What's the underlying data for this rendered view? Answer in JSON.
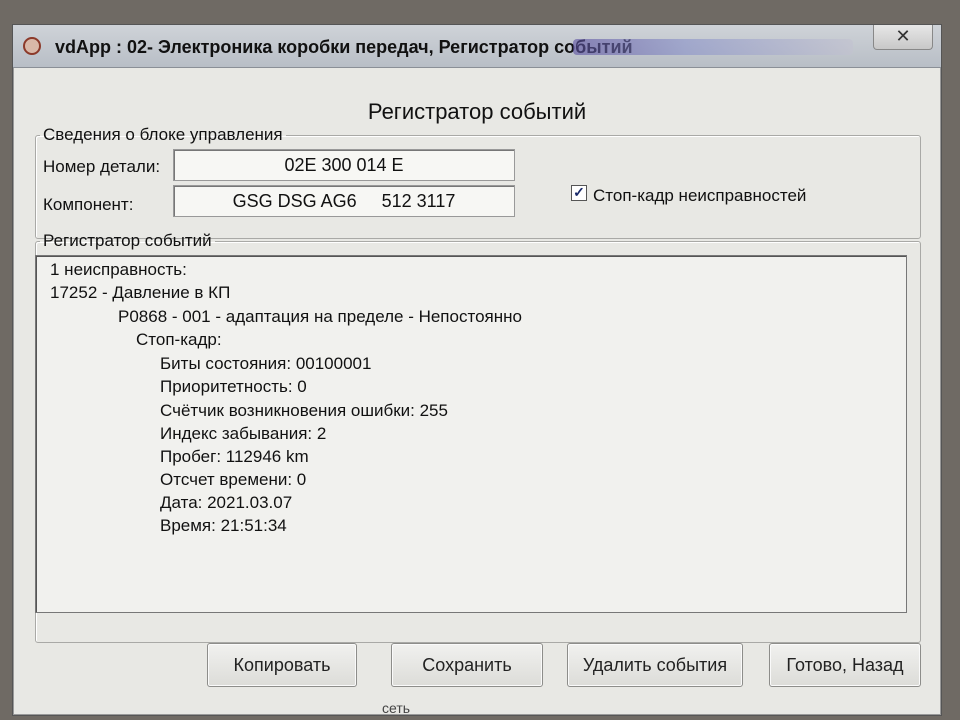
{
  "window": {
    "title": "vdApp : 02- Электроника коробки передач, Регистратор событий",
    "close_glyph": "✕"
  },
  "dialog": {
    "heading": "Регистратор событий"
  },
  "control_unit": {
    "legend": "Сведения о блоке управления",
    "part_number_label": "Номер детали:",
    "part_number_value": "02E 300 014 E",
    "component_label": "Компонент:",
    "component_value": "GSG DSG AG6     512 3117",
    "freeze_frame_checkbox_label": "Стоп-кадр неисправностей",
    "freeze_frame_checked": true,
    "check_glyph": "✓"
  },
  "events": {
    "legend": "Регистратор событий",
    "lines": [
      "1 неисправность:",
      "17252 - Давление в КП",
      "P0868 - 001 - адаптация на пределе - Непостоянно",
      "Стоп-кадр:",
      "Биты состояния: 00100001",
      "Приоритетность: 0",
      "Счётчик возникновения ошибки: 255",
      "Индекс забывания: 2",
      "Пробег: 112946 km",
      "Отсчет времени: 0",
      "Дата: 2021.03.07",
      "Время: 21:51:34"
    ]
  },
  "buttons": {
    "copy": "Копировать",
    "save": "Сохранить",
    "delete_events": "Удалить события",
    "done_back": "Готово, Назад"
  },
  "taskbar": {
    "text": "сеть"
  }
}
